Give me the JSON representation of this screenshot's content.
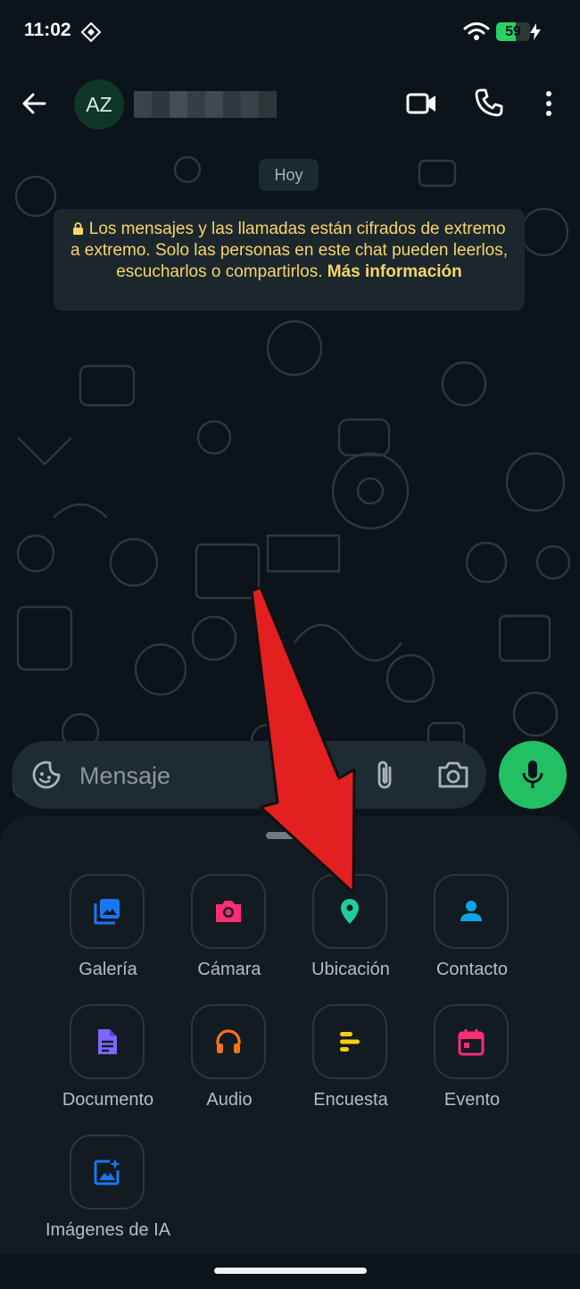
{
  "status_bar": {
    "time": "11:02",
    "battery_level": "59",
    "battery_fraction": 0.59
  },
  "header": {
    "avatar_initials": "AZ",
    "contact_name_obscured": true
  },
  "chat": {
    "date_chip": "Hoy",
    "encryption_notice_text": "Los mensajes y las llamadas están cifrados de extremo a extremo. Solo las personas en este chat pueden leerlos, escucharlos o compartirlos. ",
    "encryption_link": "Más información"
  },
  "composer": {
    "placeholder": "Mensaje"
  },
  "attach_menu": {
    "items": [
      {
        "label": "Galería",
        "icon": "gallery-icon",
        "color": "#1877f2"
      },
      {
        "label": "Cámara",
        "icon": "camera-icon",
        "color": "#ff2e74"
      },
      {
        "label": "Ubicación",
        "icon": "location-icon",
        "color": "#1fce9b"
      },
      {
        "label": "Contacto",
        "icon": "contact-icon",
        "color": "#0ea5e9"
      },
      {
        "label": "Documento",
        "icon": "document-icon",
        "color": "#7f66ff"
      },
      {
        "label": "Audio",
        "icon": "audio-icon",
        "color": "#f97316"
      },
      {
        "label": "Encuesta",
        "icon": "poll-icon",
        "color": "#facc15"
      },
      {
        "label": "Evento",
        "icon": "event-icon",
        "color": "#ff2e74"
      },
      {
        "label": "Imágenes de IA",
        "icon": "ai-images-icon",
        "color": "#1877f2"
      }
    ]
  },
  "colors": {
    "background": "#0b141a",
    "accent_green": "#21c063",
    "notice_text": "#f6d56a",
    "annotation_arrow": "#e31f1f"
  }
}
